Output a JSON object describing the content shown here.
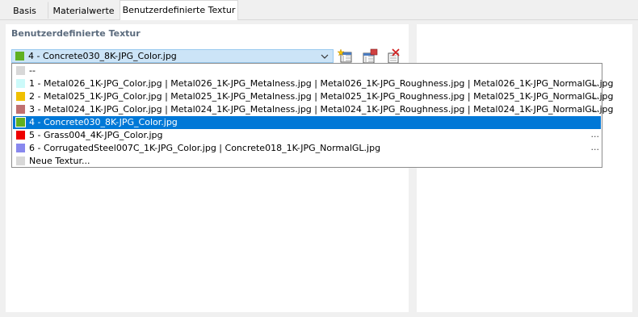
{
  "tabs": [
    {
      "label": "Basis"
    },
    {
      "label": "Materialwerte"
    },
    {
      "label": "Benutzerdefinierte Textur"
    }
  ],
  "section_title": "Benutzerdefinierte Textur",
  "combo": {
    "value": "4 - Concrete030_8K-JPG_Color.jpg",
    "color": "#60b020"
  },
  "toolbar": [
    {
      "icon": "new-texture-icon"
    },
    {
      "icon": "edit-texture-icon"
    },
    {
      "icon": "delete-texture-icon"
    }
  ],
  "options": [
    {
      "label": "--",
      "color": "#d8d8d8",
      "more": ""
    },
    {
      "label": "1 - Metal026_1K-JPG_Color.jpg | Metal026_1K-JPG_Metalness.jpg | Metal026_1K-JPG_Roughness.jpg | Metal026_1K-JPG_NormalGL.jpg",
      "color": "#ccfafa",
      "more": "..."
    },
    {
      "label": "2 - Metal025_1K-JPG_Color.jpg | Metal025_1K-JPG_Metalness.jpg | Metal025_1K-JPG_Roughness.jpg | Metal025_1K-JPG_NormalGL.jpg",
      "color": "#f0c000",
      "more": "..."
    },
    {
      "label": "3 - Metal024_1K-JPG_Color.jpg | Metal024_1K-JPG_Metalness.jpg | Metal024_1K-JPG_Roughness.jpg | Metal024_1K-JPG_NormalGL.jpg",
      "color": "#c07070",
      "more": "..."
    },
    {
      "label": "4 - Concrete030_8K-JPG_Color.jpg",
      "color": "#60b020",
      "more": ""
    },
    {
      "label": "5 - Grass004_4K-JPG_Color.jpg",
      "color": "#ee0000",
      "more": "..."
    },
    {
      "label": "6 - CorrugatedSteel007C_1K-JPG_Color.jpg | Concrete018_1K-JPG_NormalGL.jpg",
      "color": "#8888ee",
      "more": "..."
    },
    {
      "label": "Neue Textur...",
      "color": "#d8d8d8",
      "more": ""
    }
  ],
  "selected_index": 4
}
